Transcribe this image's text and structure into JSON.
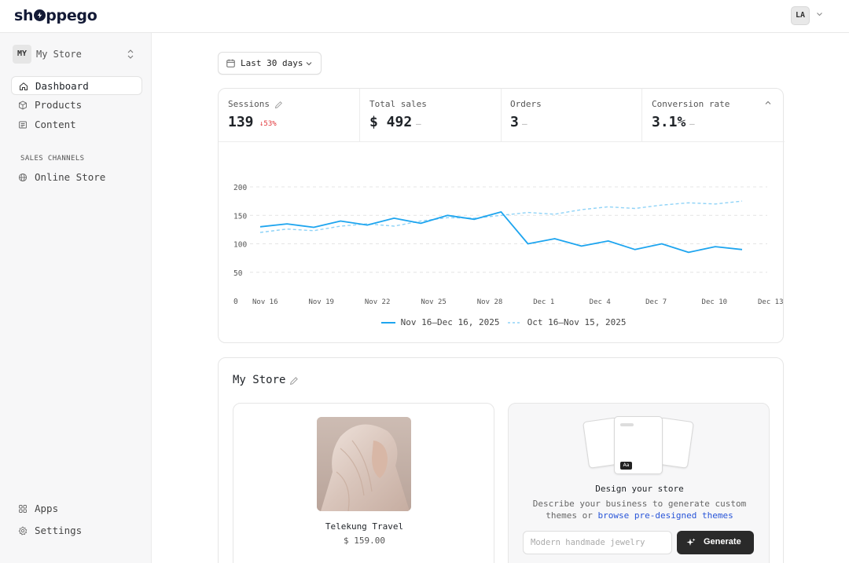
{
  "brand": {
    "logo_pre": "sh",
    "logo_post": "ppego"
  },
  "user": {
    "initials": "LA"
  },
  "sidebar": {
    "store": {
      "initials": "MY",
      "name": "My Store"
    },
    "items": [
      {
        "label": "Dashboard",
        "icon": "home-icon"
      },
      {
        "label": "Products",
        "icon": "box-icon"
      },
      {
        "label": "Content",
        "icon": "content-icon"
      }
    ],
    "section_title": "SALES CHANNELS",
    "channels": [
      {
        "label": "Online Store",
        "icon": "globe-icon"
      }
    ],
    "bottom": [
      {
        "label": "Apps",
        "icon": "apps-icon"
      },
      {
        "label": "Settings",
        "icon": "gear-icon"
      }
    ]
  },
  "date_range": {
    "label": "Last 30 days"
  },
  "metrics": [
    {
      "label": "Sessions",
      "value": "139",
      "delta": "↓53%"
    },
    {
      "label": "Total sales",
      "value": "$ 492",
      "delta": "—"
    },
    {
      "label": "Orders",
      "value": "3",
      "delta": "—"
    },
    {
      "label": "Conversion rate",
      "value": "3.1%",
      "delta": "—"
    }
  ],
  "colors": {
    "current": "#1ea5ef",
    "previous": "#8fd3f7",
    "delta_down": "#e2383c",
    "link": "#2754d8"
  },
  "chart_data": {
    "type": "line",
    "x": [
      "Nov 16",
      "Nov 19",
      "Nov 22",
      "Nov 25",
      "Nov 28",
      "Dec 1",
      "Dec 4",
      "Dec 7",
      "Dec 10",
      "Dec 13"
    ],
    "ylim": [
      0,
      200
    ],
    "yticks": [
      0,
      50,
      100,
      150,
      200
    ],
    "grid": true,
    "legend_position": "bottom",
    "series": [
      {
        "name": "Nov 16–Dec 16, 2025",
        "style": "solid",
        "values": [
          130,
          135,
          129,
          140,
          133,
          145,
          136,
          150,
          143,
          156,
          100,
          109,
          96,
          105,
          90,
          100,
          85,
          95,
          90
        ]
      },
      {
        "name": "Oct 16–Nov 15, 2025",
        "style": "dashed",
        "values": [
          120,
          126,
          123,
          131,
          135,
          131,
          140,
          146,
          145,
          150,
          155,
          152,
          160,
          165,
          162,
          168,
          172,
          170,
          175
        ]
      }
    ]
  },
  "my_store": {
    "title": "My Store",
    "product": {
      "name": "Telekung Travel",
      "price": "$ 159.00"
    },
    "design": {
      "badge": "Aa",
      "title": "Design your store",
      "desc_line1": "Describe your business to generate custom",
      "desc_line2_prefix": "themes or ",
      "desc_link": "browse pre-designed themes",
      "placeholder": "Modern handmade jewelry",
      "button": "Generate"
    }
  }
}
